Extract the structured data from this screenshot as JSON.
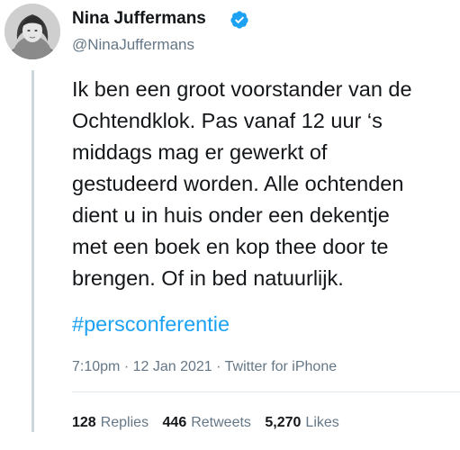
{
  "author": {
    "display_name": "Nina Juffermans",
    "handle": "@NinaJuffermans",
    "verified": true,
    "avatar_icon": "profile-photo"
  },
  "tweet": {
    "text_lines": [
      "Ik ben een groot voorstander van de",
      "Ochtendklok. Pas vanaf 12 uur ‘s",
      "middags mag er gewerkt of",
      "gestudeerd worden. Alle ochtenden",
      "dient u in huis onder een dekentje",
      "met een boek en kop thee door te",
      "brengen. Of in bed natuurlijk."
    ],
    "hashtag": "#persconferentie",
    "time": "7:10pm",
    "separator": "·",
    "date": "12 Jan 2021",
    "source": "Twitter for iPhone"
  },
  "stats": {
    "replies_count": "128",
    "replies_label": "Replies",
    "retweets_count": "446",
    "retweets_label": "Retweets",
    "likes_count": "5,270",
    "likes_label": "Likes"
  },
  "colors": {
    "accent": "#1da1f2",
    "muted": "#657786",
    "text": "#14171a",
    "thread_line": "#ccd6dd"
  }
}
